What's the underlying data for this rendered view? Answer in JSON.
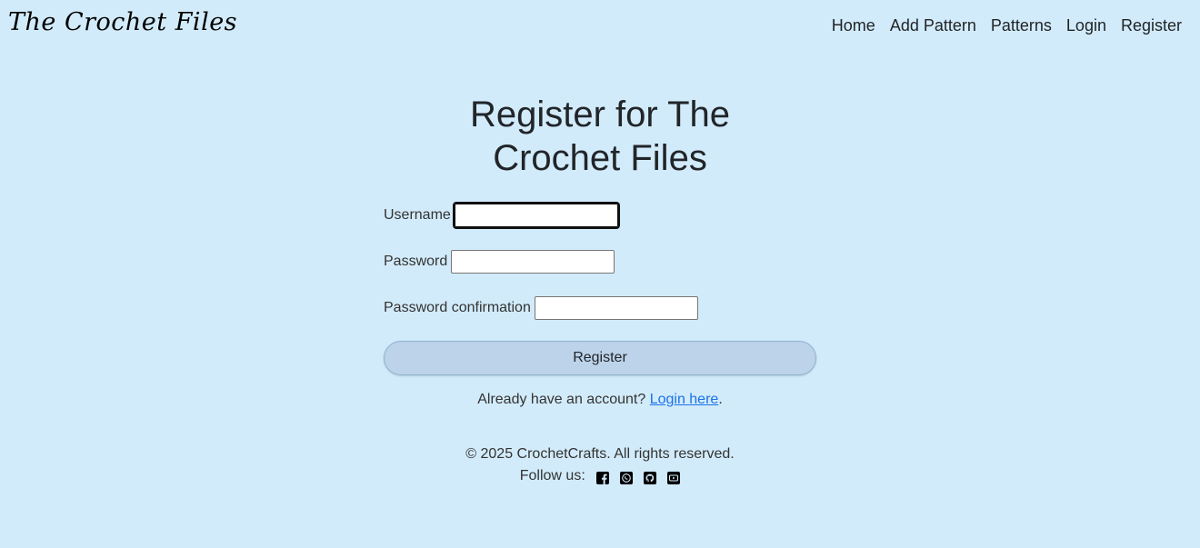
{
  "brand": "The Crochet Files",
  "nav": [
    "Home",
    "Add Pattern",
    "Patterns",
    "Login",
    "Register"
  ],
  "page": {
    "title": "Register for The Crochet Files",
    "fields": [
      {
        "label": "Username",
        "value": ""
      },
      {
        "label": "Password",
        "value": ""
      },
      {
        "label": "Password confirmation",
        "value": ""
      }
    ],
    "submit_label": "Register",
    "login_prompt": "Already have an account?",
    "login_link": "Login here",
    "login_suffix": "."
  },
  "footer": {
    "copyright": "© 2025 CrochetCrafts. All rights reserved.",
    "follow_label": "Follow us:",
    "social_icons": [
      "facebook-icon",
      "whatsapp-icon",
      "github-icon",
      "youtube-icon"
    ]
  }
}
